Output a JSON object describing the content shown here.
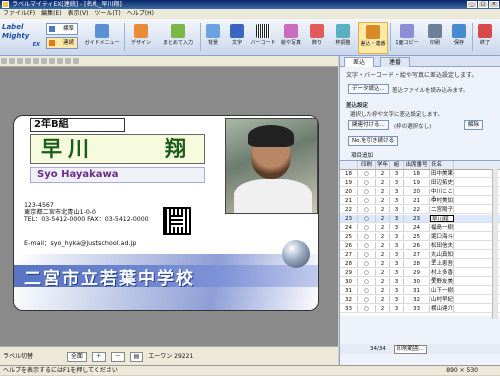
{
  "window": {
    "title": "ラベルマイティEX[連続] - [名札_早川翔]"
  },
  "menu": [
    "ファイル(F)",
    "編集(E)",
    "表示(V)",
    "ツール(T)",
    "ヘルプ(H)"
  ],
  "ribbon": {
    "logo_line1": "Label Mighty",
    "logo_line2": "EX",
    "mode_standard": "標準",
    "mode_continuous": "連続",
    "buttons": [
      "ガイドメニュー",
      "デザイン",
      "まとめて入力",
      "背景",
      "文字",
      "バーコード",
      "絵や写真",
      "飾り",
      "枠調整",
      "差込・連番",
      "1面コピー",
      "印刷",
      "保存",
      "終了"
    ]
  },
  "card": {
    "class_label": "2年B組",
    "name_family": "早川",
    "name_given": "翔",
    "romaji": "Syo Hayakawa",
    "postal": "123-4567",
    "address": "東京都二宮市北青山1-0-0",
    "tel_fax": "TEL：03-5412-0000  FAX：03-5412-0000",
    "email": "E-mail：syo_hyka@justschool.ad.jp",
    "school": "二宮市立若葉中学校"
  },
  "bottombar": {
    "label_toggle": "ラベル切替",
    "zoom_full": "全面",
    "sheet": "エーワン 29221"
  },
  "statusbar": {
    "help": "ヘルプを表示するにはF1を押してください",
    "size": "890 × 530"
  },
  "right_panel": {
    "tabs": [
      "差込",
      "連番"
    ],
    "heading": "文字・バーコード・絵や写真に差込設定します。",
    "data_button": "データ読込...",
    "data_info": "差込ファイルを読み込みます。",
    "setting_title": "差込設定",
    "setting_info": "選択した枠や文字に差込設定します。",
    "link_button": "関連付ける...",
    "link_value": "(枠の選択なし)",
    "release_button": "解除",
    "tail_button": "No.を引き続ける",
    "grid_add": "項目追加",
    "columns": [
      "",
      "印刷",
      "学年",
      "組",
      "出席番号",
      "氏名"
    ],
    "rows": [
      [
        "18",
        "○",
        "2",
        "3",
        "18",
        "田中美果"
      ],
      [
        "19",
        "○",
        "2",
        "3",
        "19",
        "田辺拓史"
      ],
      [
        "20",
        "○",
        "2",
        "3",
        "20",
        "中川こころ"
      ],
      [
        "21",
        "○",
        "2",
        "3",
        "21",
        "中村美加"
      ],
      [
        "22",
        "○",
        "2",
        "3",
        "22",
        "二宮陽子"
      ],
      [
        "23",
        "○",
        "2",
        "3",
        "23",
        "早川翔"
      ],
      [
        "24",
        "○",
        "2",
        "3",
        "24",
        "福島一樹"
      ],
      [
        "25",
        "○",
        "2",
        "3",
        "25",
        "堀口海斗"
      ],
      [
        "26",
        "○",
        "2",
        "3",
        "26",
        "松田信夫"
      ],
      [
        "27",
        "○",
        "2",
        "3",
        "27",
        "丸山真知子"
      ],
      [
        "28",
        "○",
        "2",
        "3",
        "28",
        "三上恵吾"
      ],
      [
        "29",
        "○",
        "2",
        "3",
        "29",
        "村上多香子"
      ],
      [
        "30",
        "○",
        "2",
        "3",
        "30",
        "矢野友美"
      ],
      [
        "31",
        "○",
        "2",
        "3",
        "31",
        "山下一樹"
      ],
      [
        "32",
        "○",
        "2",
        "3",
        "32",
        "山村早紀"
      ],
      [
        "33",
        "○",
        "2",
        "3",
        "33",
        "横山達介"
      ]
    ],
    "selected_row": 5,
    "pager_text": "34/34",
    "print_range": "印刷範囲..."
  }
}
